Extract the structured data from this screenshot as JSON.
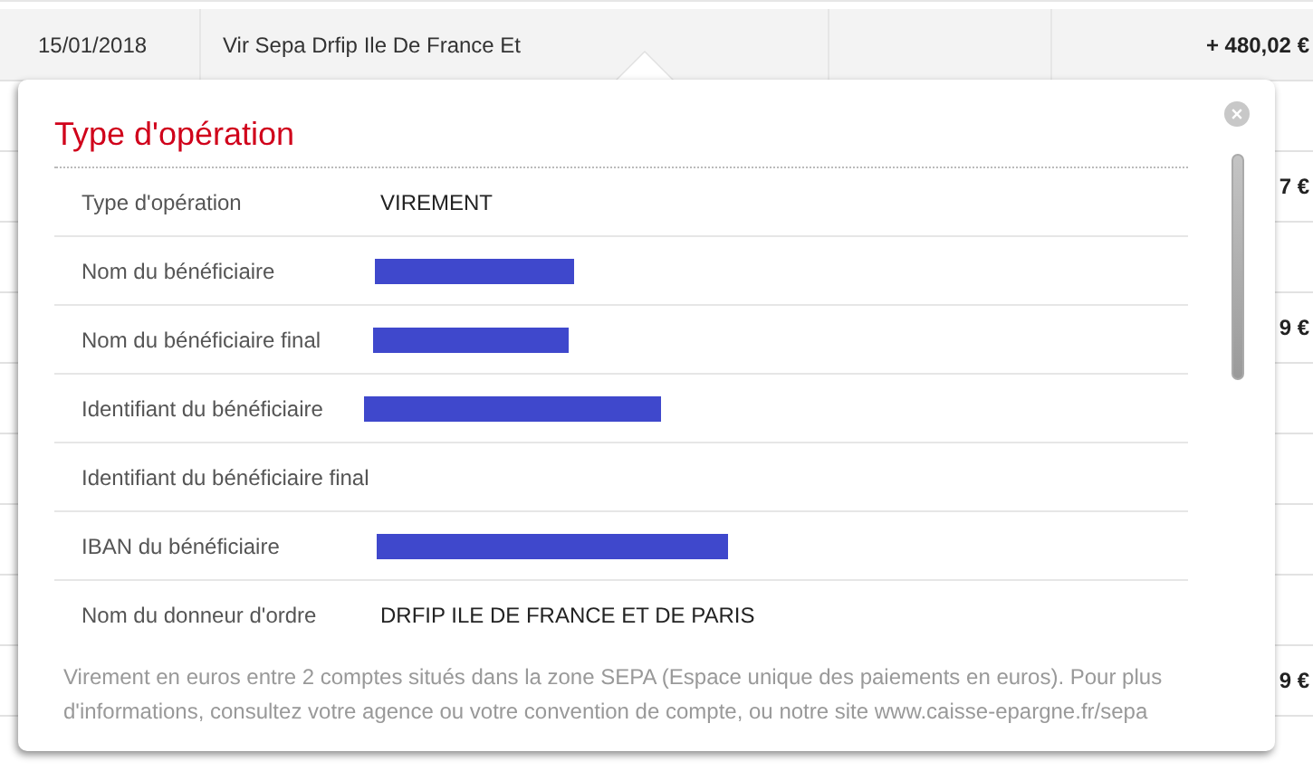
{
  "transaction": {
    "date": "15/01/2018",
    "label": "Vir Sepa Drfip Ile De France Et",
    "amount": "+ 480,02 €"
  },
  "background_rows": [
    {
      "amount": ""
    },
    {
      "amount": "7 €"
    },
    {
      "amount": ""
    },
    {
      "amount": "9 €"
    },
    {
      "amount": ""
    },
    {
      "amount": ""
    },
    {
      "amount": ""
    },
    {
      "amount": ""
    },
    {
      "amount": "9 €"
    }
  ],
  "popup": {
    "title": "Type d'opération",
    "rows": [
      {
        "label": "Type d'opération",
        "kind": "text",
        "value": "VIREMENT"
      },
      {
        "label": "Nom du bénéficiaire",
        "kind": "redacted"
      },
      {
        "label": "Nom du bénéficiaire final",
        "kind": "redacted"
      },
      {
        "label": "Identifiant du bénéficiaire",
        "kind": "redacted"
      },
      {
        "label": "Identifiant du bénéficiaire final",
        "kind": "empty"
      },
      {
        "label": "IBAN du bénéficiaire",
        "kind": "redacted"
      },
      {
        "label": "Nom du donneur d'ordre",
        "kind": "text",
        "value": "DRFIP ILE DE FRANCE ET DE PARIS"
      }
    ],
    "note": "Virement en euros entre 2 comptes situés dans la zone SEPA (Espace unique des paiements en euros). Pour plus d'informations, consultez votre agence ou votre convention de compte, ou notre site www.caisse-epargne.fr/sepa"
  }
}
